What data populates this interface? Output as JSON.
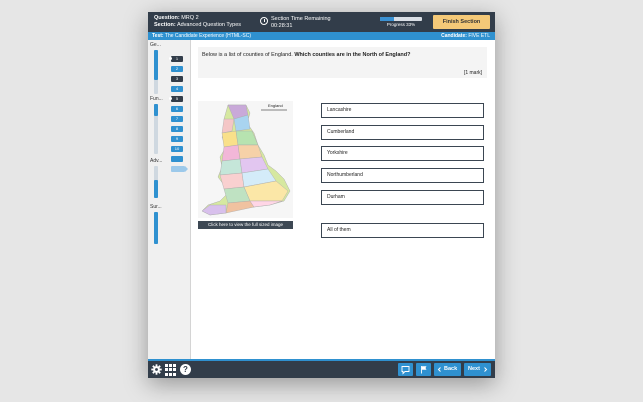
{
  "header": {
    "question_label": "Question:",
    "question_value": "MRQ 2",
    "section_label": "Section:",
    "section_value": "Advanced Question Types",
    "timer_label": "Section Time Remaining",
    "timer_value": "00:28:31",
    "progress_label": "Progress 33%",
    "progress_fraction": 0.33,
    "finish_label": "Finish Section"
  },
  "testbar": {
    "test_label": "Test:",
    "test_value": "The Candidate Experience (HTML-SC)",
    "candidate_label": "Candidate:",
    "candidate_value": "FIVE ETL"
  },
  "sidebar": {
    "sections": [
      "Ge...",
      "Fun...",
      "Adv...",
      "Sur..."
    ],
    "question_numbers": [
      "1",
      "2",
      "3",
      "4",
      "5",
      "6",
      "7",
      "8",
      "9",
      "10"
    ]
  },
  "question": {
    "text_plain": "Below is a list of counties of England. ",
    "text_bold": "Which counties are in the North of England?",
    "mark": "[1 mark]",
    "map_title": "England",
    "view_image_button": "Click here to view the full sized image",
    "options": [
      "Lancashire",
      "Cumberland",
      "Yorkshire",
      "Northumberland",
      "Durham",
      "All of them"
    ]
  },
  "footer": {
    "back_label": "Back",
    "next_label": "Next"
  },
  "colors": {
    "dark": "#323d4a",
    "accent": "#2f91d0",
    "finish": "#f4c978"
  }
}
